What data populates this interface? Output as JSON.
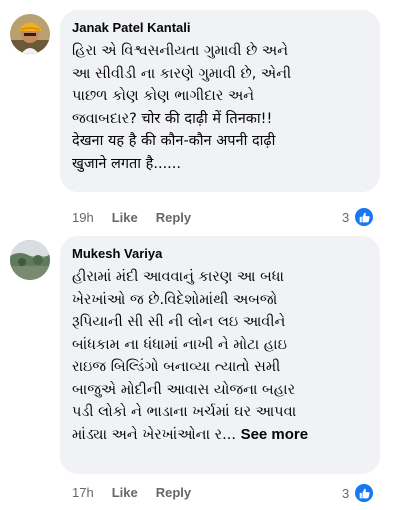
{
  "comments": [
    {
      "author": "Janak Patel Kantali",
      "text": "હિરા એ વિશ્વસનીયતા ગુમાવી છે અને\nઆ સીવીડી ના કારણે ગુમાવી છે, એની\nપાછળ કોણ કોણ ભાગીદાર અને\nજવાબદાર? चोर की दाढ़ी में तिनका!!\nदेखना यह है की कौन-कौन अपनी दाढ़ी\nखुजाने लगता है......",
      "see_more": "",
      "time": "19h",
      "like_label": "Like",
      "reply_label": "Reply",
      "reaction_count": "3",
      "avatar_icon": "profile-photo-man-with-turban",
      "accent_color": "#1877f2"
    },
    {
      "author": "Mukesh Variya",
      "text": "હીરામાં મંદી આવવાનું કારણ આ બધા\nખેરખાંઓ જ છે.વિદેશોમાંથી અબજો\nરૂપિયાની સી સી ની લોન લઇ આવીને\nબાંધકામ ના ધંધામાં નાખી ને મોટા હાઇ\nરાઇજ બિલ્ડિંગો બનાવ્યા ત્યાતો સમી\nબાજુએ મોદીની આવાસ યોજના બહાર\nપડી લોકો ને ભાડાના ખર્ચમાં ઘર આપવા\nમાંડ્યા અને ખેરખાંઓના ર...",
      "see_more": "See more",
      "time": "17h",
      "like_label": "Like",
      "reply_label": "Reply",
      "reaction_count": "3",
      "avatar_icon": "profile-photo-landscape",
      "accent_color": "#1877f2"
    }
  ],
  "colors": {
    "bubble_bg": "#f0f2f5",
    "meta_text": "#65676b",
    "like_blue": "#1877f2"
  }
}
